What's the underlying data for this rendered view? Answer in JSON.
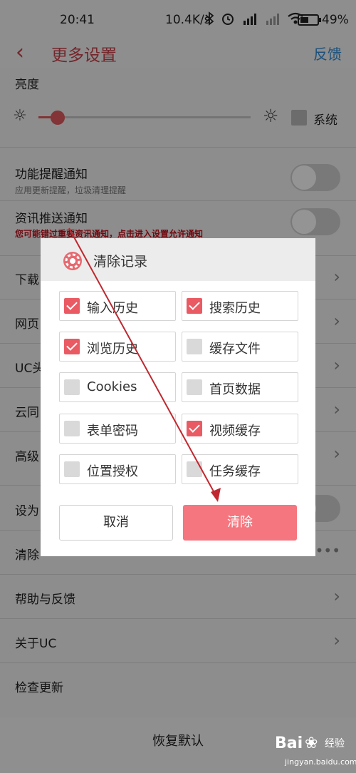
{
  "status_bar": {
    "time": "20:41",
    "net_speed": "10.4K/s",
    "icons": [
      "bluetooth-icon",
      "alarm-icon",
      "hd-signal-icon",
      "signal-icon",
      "wifi-icon"
    ],
    "battery": "49%"
  },
  "header": {
    "title": "更多设置",
    "back_icon": "back-chevron-icon",
    "right_link": "反馈"
  },
  "brightness": {
    "label": "亮度",
    "system_label": "系统",
    "level": 0.09
  },
  "settings": [
    {
      "title": "功能提醒通知",
      "subtitle": "应用更新提醒，垃圾清理提醒"
    },
    {
      "title": "资讯推送通知",
      "subtitle": "您可能错过重要资讯通知，点击进入设置允许通知"
    }
  ],
  "menu_rows": [
    {
      "label": "下载"
    },
    {
      "label": "网页"
    },
    {
      "label": "UC头"
    },
    {
      "label": "云同"
    },
    {
      "label": "高级"
    },
    {
      "label": "设为"
    },
    {
      "label": "清除"
    },
    {
      "label": "帮助与反馈"
    },
    {
      "label": "关于UC"
    },
    {
      "label": "检查更新"
    }
  ],
  "restore_label": "恢复默认",
  "dialog": {
    "title": "清除记录",
    "options": [
      {
        "label": "输入历史",
        "checked": true
      },
      {
        "label": "搜索历史",
        "checked": true
      },
      {
        "label": "浏览历史",
        "checked": true
      },
      {
        "label": "缓存文件",
        "checked": false
      },
      {
        "label": "Cookies",
        "checked": false
      },
      {
        "label": "首页数据",
        "checked": false
      },
      {
        "label": "表单密码",
        "checked": false
      },
      {
        "label": "视频缓存",
        "checked": true
      },
      {
        "label": "位置授权",
        "checked": false
      },
      {
        "label": "任务缓存",
        "checked": false
      }
    ],
    "cancel_label": "取消",
    "clear_label": "清除"
  },
  "watermark": {
    "brand": "Bai",
    "jingyan": "经验",
    "url": "jingyan.baidu.com"
  },
  "colors": {
    "accent": "#c9424a",
    "clear_button": "#f5767e",
    "checkbox_on": "#ea5a63",
    "link": "#2f8ad6",
    "annotation_arrow": "#c0282f"
  }
}
